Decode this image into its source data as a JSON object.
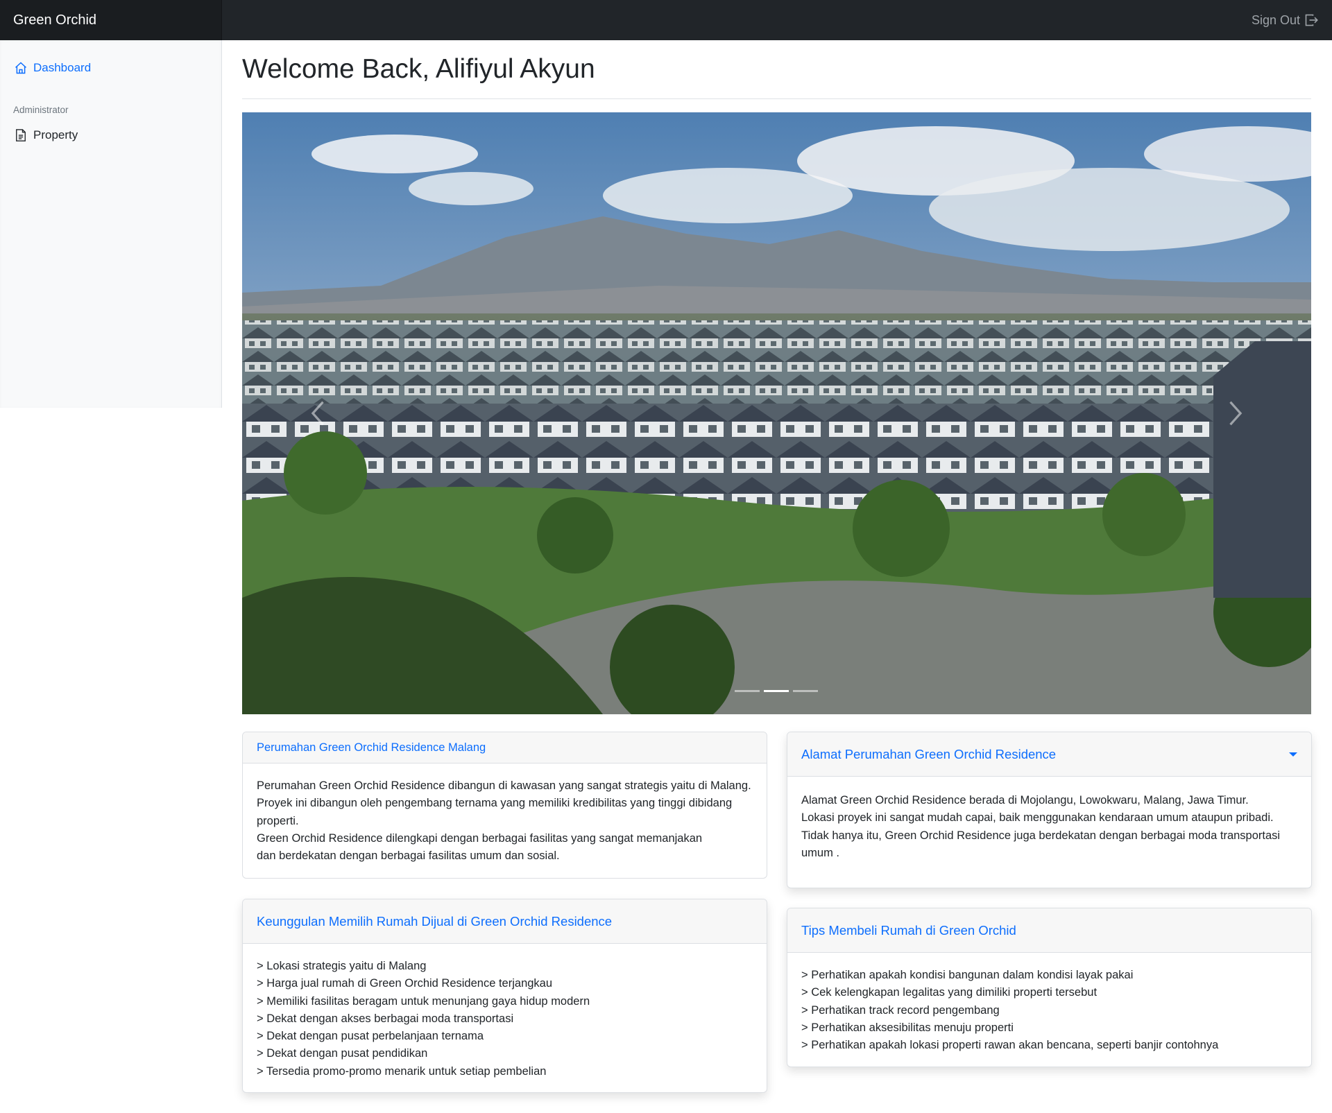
{
  "app": {
    "brand": "Green Orchid",
    "sign_out": "Sign Out"
  },
  "sidebar": {
    "dashboard": "Dashboard",
    "heading": "Administrator",
    "property": "Property"
  },
  "page": {
    "title": "Welcome Back, Alifiyul Akyun"
  },
  "carousel": {
    "slide_count": 3,
    "active_index": 1
  },
  "cards": {
    "intro": {
      "header": "Perumahan Green Orchid Residence Malang",
      "lines": [
        "Perumahan Green Orchid Residence dibangun di kawasan yang sangat strategis yaitu di Malang.",
        "Proyek ini dibangun oleh pengembang ternama yang memiliki kredibilitas yang tinggi dibidang",
        "properti.",
        "Green Orchid Residence dilengkapi dengan berbagai fasilitas yang sangat memanjakan",
        "dan berdekatan dengan berbagai fasilitas umum dan sosial."
      ]
    },
    "address": {
      "header": "Alamat Perumahan Green Orchid Residence",
      "lines": [
        "Alamat Green Orchid Residence berada di Mojolangu, Lowokwaru, Malang, Jawa Timur.",
        "Lokasi proyek ini sangat mudah capai, baik menggunakan kendaraan umum ataupun pribadi.",
        "Tidak hanya itu, Green Orchid Residence juga berdekatan dengan berbagai moda transportasi",
        "umum ."
      ]
    },
    "advantages": {
      "header": "Keunggulan Memilih Rumah Dijual di Green Orchid Residence",
      "items": [
        "> Lokasi strategis yaitu di Malang",
        "> Harga jual rumah di Green Orchid Residence terjangkau",
        "> Memiliki fasilitas beragam untuk menunjang gaya hidup modern",
        "> Dekat dengan akses berbagai moda transportasi",
        "> Dekat dengan pusat perbelanjaan ternama",
        "> Dekat dengan pusat pendidikan",
        "> Tersedia promo-promo menarik untuk setiap pembelian"
      ]
    },
    "tips": {
      "header": "Tips Membeli Rumah di Green Orchid",
      "items": [
        "> Perhatikan apakah kondisi bangunan dalam kondisi layak pakai",
        "> Cek kelengkapan legalitas yang dimiliki properti tersebut",
        "> Perhatikan track record pengembang",
        "> Perhatikan aksesibilitas menuju properti",
        "> Perhatikan apakah lokasi properti rawan akan bencana, seperti banjir contohnya"
      ]
    }
  },
  "colors": {
    "navbar": "#212529",
    "accent": "#0d6efd",
    "sidebar_bg": "#f8f9fa"
  },
  "icons": [
    "house-icon",
    "file-text-icon",
    "sign-out-icon",
    "chevron-left-icon",
    "chevron-right-icon",
    "caret-down-icon"
  ]
}
